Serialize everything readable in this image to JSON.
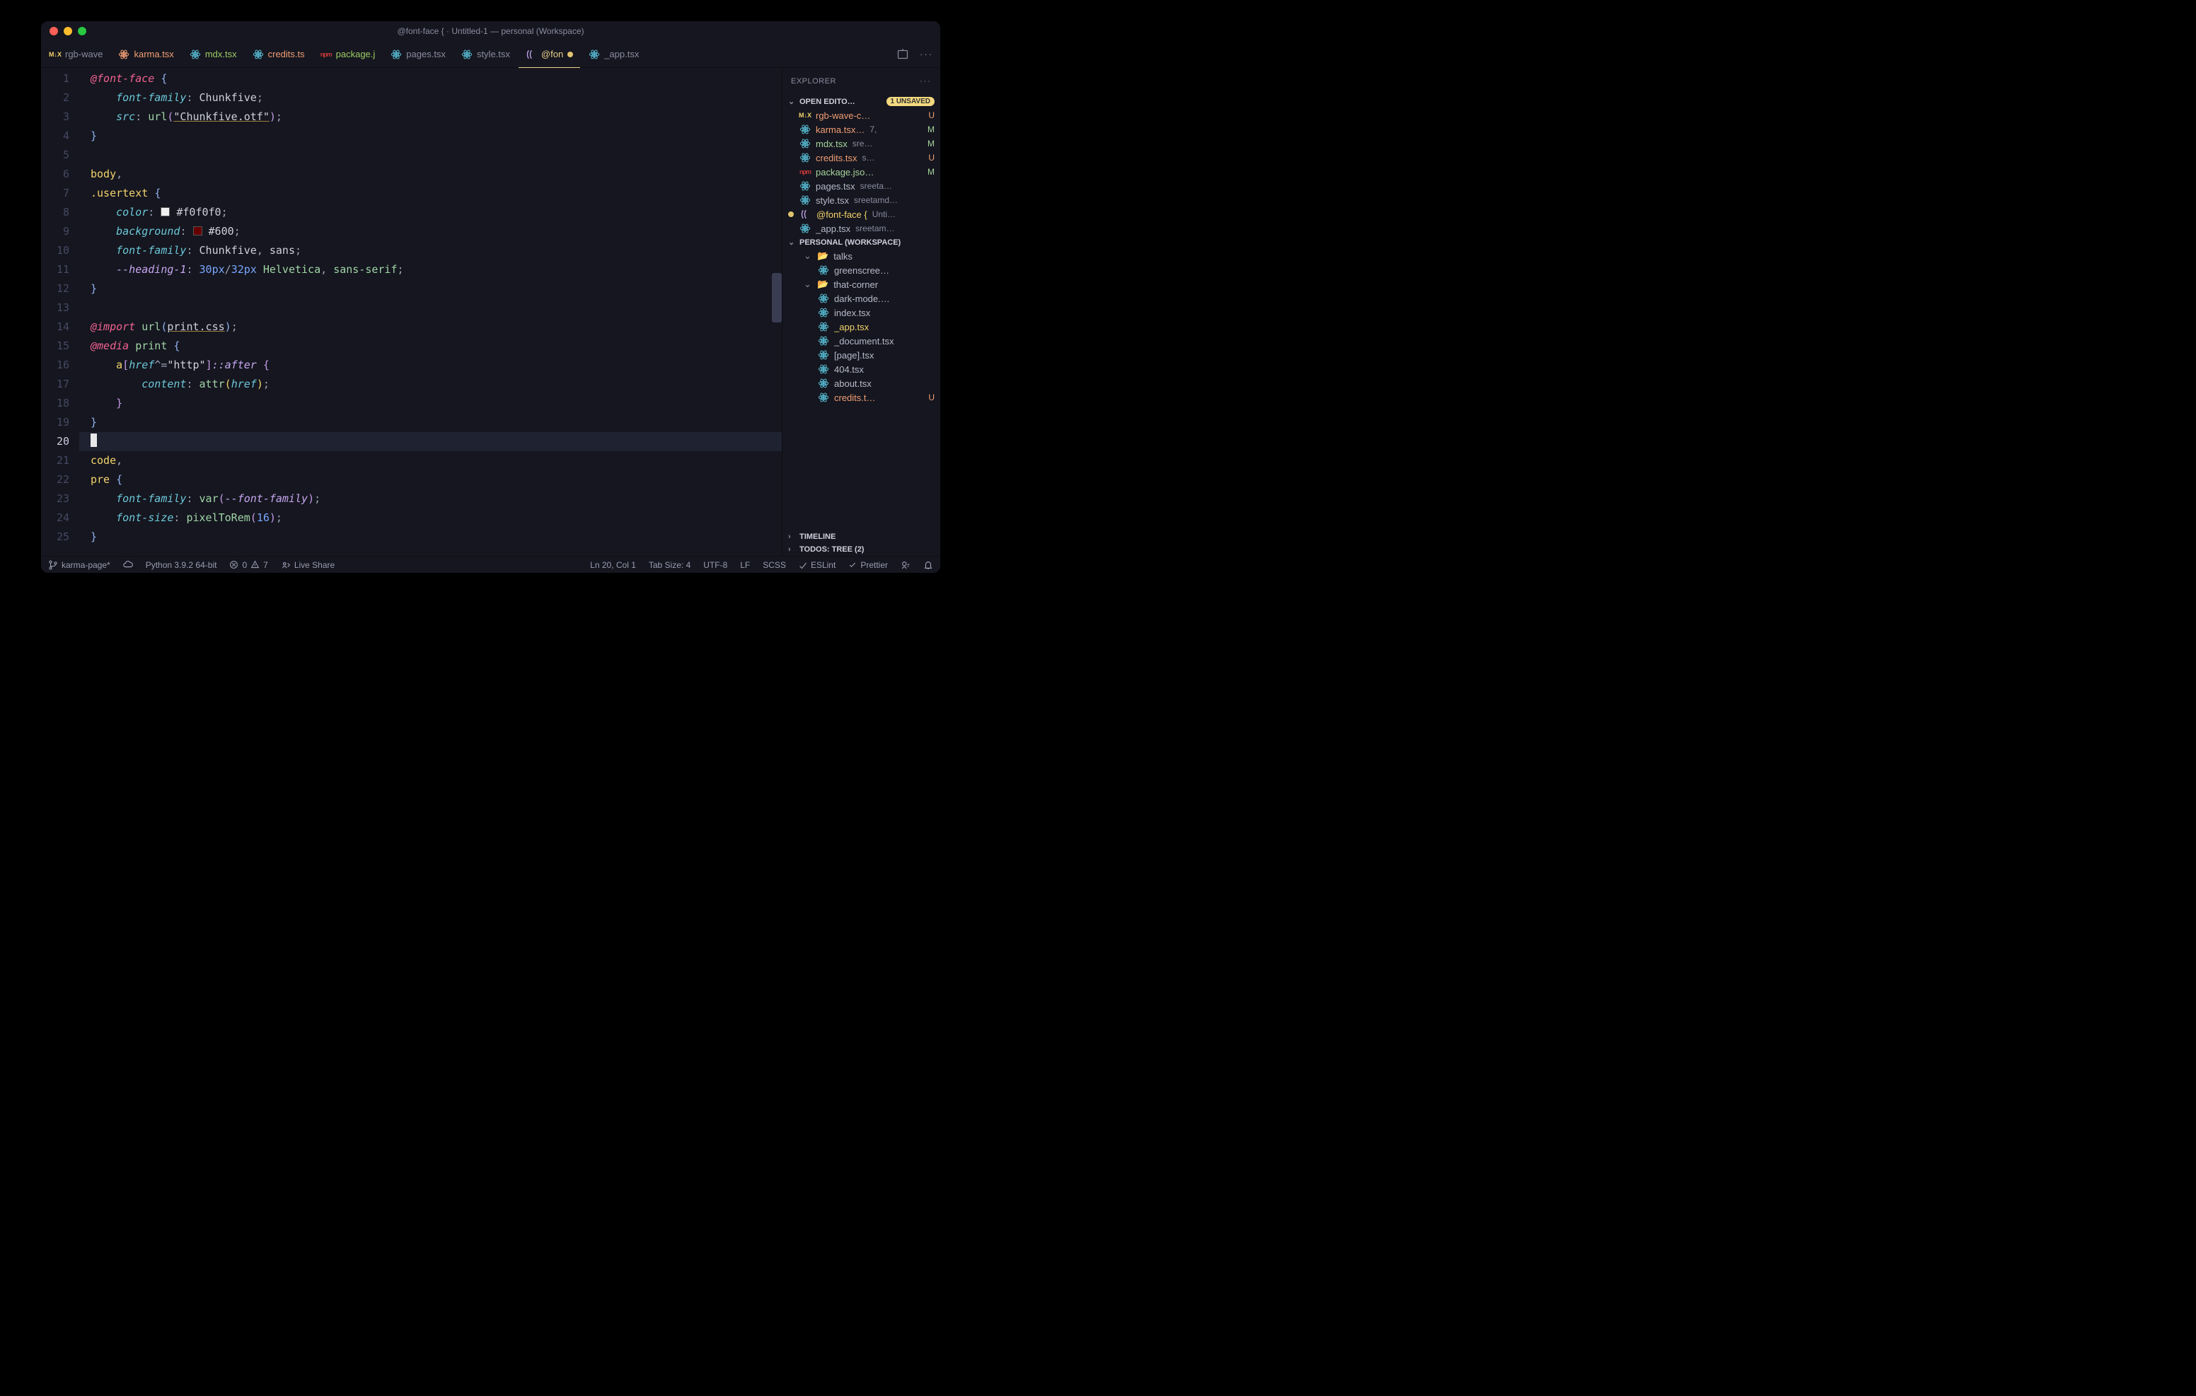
{
  "window_title": "@font-face { · Untitled-1 — personal (Workspace)",
  "tabs": [
    {
      "label": "rgb-wave",
      "icon": "mdx"
    },
    {
      "label": "karma.tsx",
      "icon": "react"
    },
    {
      "label": "mdx.tsx",
      "icon": "react"
    },
    {
      "label": "credits.ts",
      "icon": "react"
    },
    {
      "label": "package.j",
      "icon": "npm"
    },
    {
      "label": "pages.tsx",
      "icon": "react"
    },
    {
      "label": "style.tsx",
      "icon": "react"
    },
    {
      "label": "@fon",
      "icon": "css",
      "active": true,
      "dirty": true
    },
    {
      "label": "_app.tsx",
      "icon": "react"
    }
  ],
  "sidebar": {
    "title": "EXPLORER",
    "open_editors_label": "OPEN EDITO…",
    "unsaved_badge": "1 UNSAVED",
    "open_editors": [
      {
        "name": "rgb-wave-c…",
        "status": "U",
        "icon": "mdx"
      },
      {
        "name": "karma.tsx…",
        "path": "7,",
        "status": "M",
        "icon": "react"
      },
      {
        "name": "mdx.tsx",
        "path": "sre…",
        "status": "M",
        "icon": "react"
      },
      {
        "name": "credits.tsx",
        "path": "s…",
        "status": "U",
        "icon": "react"
      },
      {
        "name": "package.jso…",
        "status": "M",
        "icon": "npm"
      },
      {
        "name": "pages.tsx",
        "path": "sreeta…",
        "icon": "react"
      },
      {
        "name": "style.tsx",
        "path": "sreetamd…",
        "icon": "react"
      },
      {
        "name": "@font-face {",
        "path": "Unti…",
        "icon": "css",
        "dirty": true,
        "active": true
      },
      {
        "name": "_app.tsx",
        "path": "sreetam…",
        "icon": "react"
      }
    ],
    "workspace_label": "PERSONAL (WORKSPACE)",
    "tree": {
      "talks": "talks",
      "greenscreen": "greenscree…",
      "that_corner": "that-corner",
      "files": [
        {
          "name": "dark-mode.…",
          "icon": "react"
        },
        {
          "name": "index.tsx",
          "icon": "react"
        },
        {
          "name": "_app.tsx",
          "icon": "react",
          "mod": true
        },
        {
          "name": "_document.tsx",
          "icon": "react"
        },
        {
          "name": "[page].tsx",
          "icon": "react"
        },
        {
          "name": "404.tsx",
          "icon": "react"
        },
        {
          "name": "about.tsx",
          "icon": "react"
        },
        {
          "name": "credits.t…",
          "icon": "react",
          "status": "U"
        }
      ]
    },
    "timeline_label": "TIMELINE",
    "todos_label": "TODOS: TREE (2)"
  },
  "statusbar": {
    "branch": "karma-page*",
    "python": "Python 3.9.2 64-bit",
    "errors": "0",
    "warnings": "7",
    "liveshare": "Live Share",
    "cursor": "Ln 20, Col 1",
    "tabsize": "Tab Size: 4",
    "encoding": "UTF-8",
    "eol": "LF",
    "lang": "SCSS",
    "eslint": "ESLint",
    "prettier": "Prettier"
  },
  "code_lines": 25,
  "current_line": 20
}
